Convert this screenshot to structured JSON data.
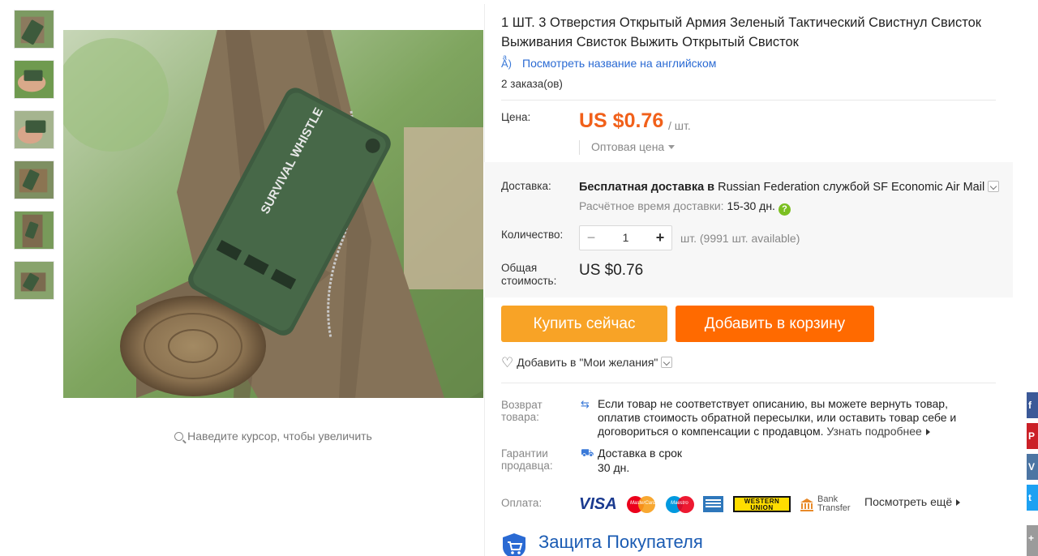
{
  "gallery": {
    "thumbnail_count": 6,
    "zoom_hint": "Наведите курсор, чтобы увеличить",
    "image_text": "SURVIVAL WHISTLE"
  },
  "product": {
    "title": "1 ШТ. 3 Отверстия Открытый Армия Зеленый Тактический Свистнул Свисток Выживания Свисток Выжить Открытый Свисток",
    "translate_link": "Посмотреть название на английском",
    "orders": "2 заказа(ов)"
  },
  "price": {
    "label": "Цена:",
    "value": "US $0.76",
    "unit": "/ шт.",
    "wholesale": "Оптовая цена"
  },
  "shipping": {
    "label": "Доставка:",
    "free_text": "Бесплатная доставка",
    "in": "в",
    "country": "Russian Federation",
    "via": "службой",
    "carrier": "SF Economic Air Mail",
    "eta_label": "Расчётное время доставки:",
    "eta_days": "15-30 дн."
  },
  "quantity": {
    "label": "Количество:",
    "minus": "−",
    "value": "1",
    "plus": "+",
    "available": "шт. (9991 шт. available)"
  },
  "total": {
    "label": "Общая стоимость:",
    "value": "US $0.76"
  },
  "buttons": {
    "buy_now": "Купить сейчас",
    "add_to_cart": "Добавить в корзину"
  },
  "wishlist": {
    "label": "Добавить в \"Мои желания\""
  },
  "returns": {
    "label": "Возврат товара:",
    "text": "Если товар не соответствует описанию, вы можете вернуть товар, оплатив стоимость обратной пересылки, или оставить товар себе и договориться о компенсации с продавцом.",
    "more": "Узнать подробнее"
  },
  "guarantee": {
    "label": "Гарантии продавца:",
    "text": "Доставка в срок",
    "days": "30 дн."
  },
  "payment": {
    "label": "Оплата:",
    "visa": "VISA",
    "mastercard": "MasterCard",
    "maestro": "Maestro",
    "western_union_1": "WESTERN",
    "western_union_2": "UNION",
    "bank_transfer_1": "Bank",
    "bank_transfer_2": "Transfer",
    "more": "Посмотреть ещё"
  },
  "buyer_protection": {
    "title": "Защита Покупателя"
  },
  "share": {
    "buttons": [
      {
        "icon": "facebook-icon",
        "color": "#3b5998",
        "glyph": "f"
      },
      {
        "icon": "pinterest-icon",
        "color": "#cb2027",
        "glyph": "P"
      },
      {
        "icon": "vk-icon",
        "color": "#4c75a3",
        "glyph": "V"
      },
      {
        "icon": "twitter-icon",
        "color": "#1da1f2",
        "glyph": "t"
      },
      {
        "icon": "more-share-icon",
        "color": "#9b9b9b",
        "glyph": "+"
      }
    ]
  },
  "colors": {
    "price_orange": "#f1601a",
    "buy_now_bg": "#f8a326",
    "add_cart_bg": "#ff6a00",
    "link_blue": "#2a6ad3"
  }
}
